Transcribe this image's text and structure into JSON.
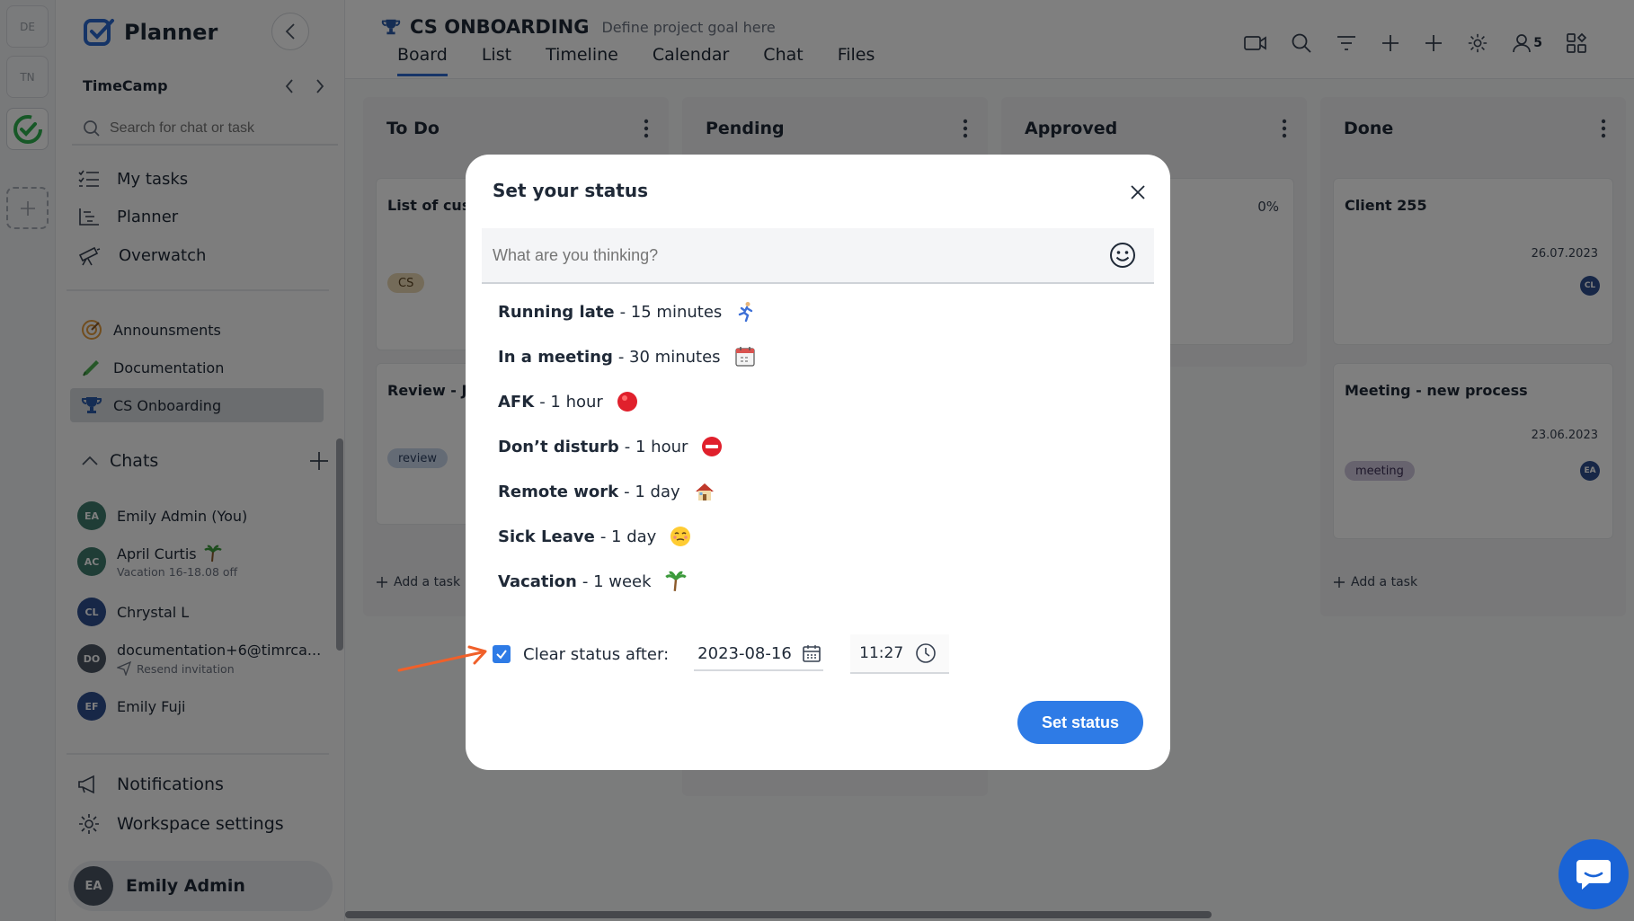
{
  "rail": {
    "items": [
      "DE",
      "TN"
    ]
  },
  "sidebar": {
    "app_name": "Planner",
    "workspace": "TimeCamp",
    "search_placeholder": "Search for chat or task",
    "nav": [
      {
        "label": "My tasks",
        "icon": "list-check-icon"
      },
      {
        "label": "Planner",
        "icon": "chart-icon"
      },
      {
        "label": "Overwatch",
        "icon": "telescope-icon"
      }
    ],
    "projects": [
      {
        "label": "Announsments",
        "icon": "target-icon"
      },
      {
        "label": "Documentation",
        "icon": "pen-icon"
      },
      {
        "label": "CS Onboarding",
        "icon": "trophy-icon"
      }
    ],
    "chats_title": "Chats",
    "chats": [
      {
        "initials": "EA",
        "name": "Emily Admin (You)",
        "color": "#3e7b6c"
      },
      {
        "initials": "AC",
        "name": "April Curtis",
        "sub": "Vacation 16-18.08 off",
        "color": "#3e7b6c"
      },
      {
        "initials": "CL",
        "name": "Chrystal L",
        "color": "#2e4f8f"
      },
      {
        "initials": "DO",
        "name": "documentation+6@timrca...",
        "sub": "Resend invitation",
        "color": "#4b5563"
      },
      {
        "initials": "EF",
        "name": "Emily Fuji",
        "color": "#2e4f8f"
      }
    ],
    "notifications": "Notifications",
    "workspace_settings": "Workspace settings",
    "user": {
      "initials": "EA",
      "name": "Emily Admin"
    }
  },
  "header": {
    "title": "CS ONBOARDING",
    "goal": "Define project goal here",
    "tabs": [
      "Board",
      "List",
      "Timeline",
      "Calendar",
      "Chat",
      "Files"
    ],
    "members_count": "5"
  },
  "board": {
    "columns": [
      {
        "title": "To Do"
      },
      {
        "title": "Pending"
      },
      {
        "title": "Approved"
      },
      {
        "title": "Done"
      }
    ],
    "cards": {
      "todo1_title": "List of custo",
      "todo1_tag": "CS",
      "todo2_title": "Review - Ju",
      "todo2_tag": "review",
      "approved_pct": "0%",
      "done1_title": "Client 255",
      "done1_date": "26.07.2023",
      "done1_avatar": "CL",
      "done2_title": "Meeting - new process",
      "done2_date": "23.06.2023",
      "done2_tag": "meeting",
      "done2_avatar": "EA"
    },
    "add_task": "Add a task"
  },
  "modal": {
    "title": "Set your status",
    "input_placeholder": "What are you thinking?",
    "presets": [
      {
        "label": "Running late",
        "duration": "- 15 minutes",
        "emoji": "runner-emoji"
      },
      {
        "label": "In a meeting",
        "duration": "- 30 minutes",
        "emoji": "calendar-emoji"
      },
      {
        "label": "AFK",
        "duration": "- 1 hour",
        "emoji": "red-circle-emoji"
      },
      {
        "label": "Don’t disturb",
        "duration": "- 1 hour",
        "emoji": "no-entry-emoji"
      },
      {
        "label": "Remote work",
        "duration": "- 1 day",
        "emoji": "house-emoji"
      },
      {
        "label": "Sick Leave",
        "duration": "- 1 day",
        "emoji": "sick-face-emoji"
      },
      {
        "label": "Vacation",
        "duration": "- 1 week",
        "emoji": "palm-tree-emoji"
      }
    ],
    "clear_label": "Clear status after:",
    "clear_checked": true,
    "date": "2023-08-16",
    "time": "11:27",
    "submit": "Set status"
  },
  "colors": {
    "accent": "#2e7be6",
    "arrow": "#f0602a",
    "help": "#1963d6"
  }
}
